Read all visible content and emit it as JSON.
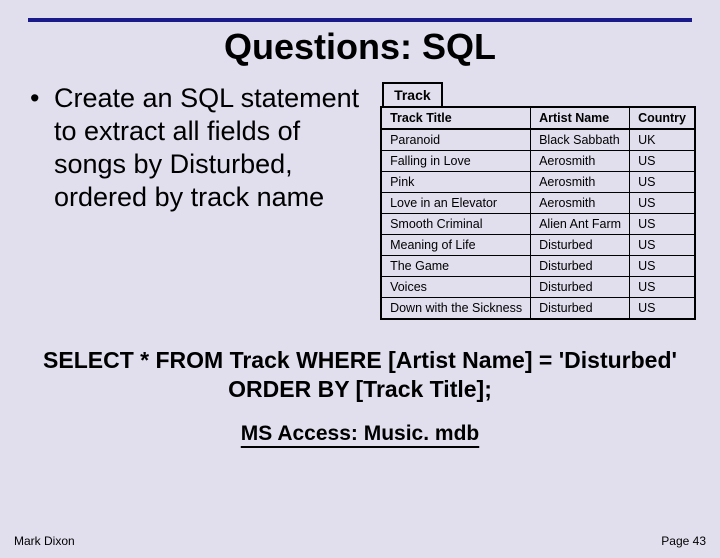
{
  "title": "Questions: SQL",
  "bullet": {
    "marker": "•",
    "text": "Create an SQL statement to extract all fields of songs by Disturbed, ordered by track name"
  },
  "table": {
    "label": "Track",
    "headers": [
      "Track Title",
      "Artist Name",
      "Country"
    ],
    "rows": [
      [
        "Paranoid",
        "Black Sabbath",
        "UK"
      ],
      [
        "Falling in Love",
        "Aerosmith",
        "US"
      ],
      [
        "Pink",
        "Aerosmith",
        "US"
      ],
      [
        "Love in an Elevator",
        "Aerosmith",
        "US"
      ],
      [
        "Smooth Criminal",
        "Alien Ant Farm",
        "US"
      ],
      [
        "Meaning of Life",
        "Disturbed",
        "US"
      ],
      [
        "The Game",
        "Disturbed",
        "US"
      ],
      [
        "Voices",
        "Disturbed",
        "US"
      ],
      [
        "Down with the Sickness",
        "Disturbed",
        "US"
      ]
    ]
  },
  "sql": {
    "line1": "SELECT * FROM Track WHERE [Artist Name] = 'Disturbed'",
    "line2": "ORDER BY [Track Title];"
  },
  "caption": "MS Access: Music. mdb",
  "footer": {
    "author": "Mark Dixon",
    "page": "Page 43"
  }
}
